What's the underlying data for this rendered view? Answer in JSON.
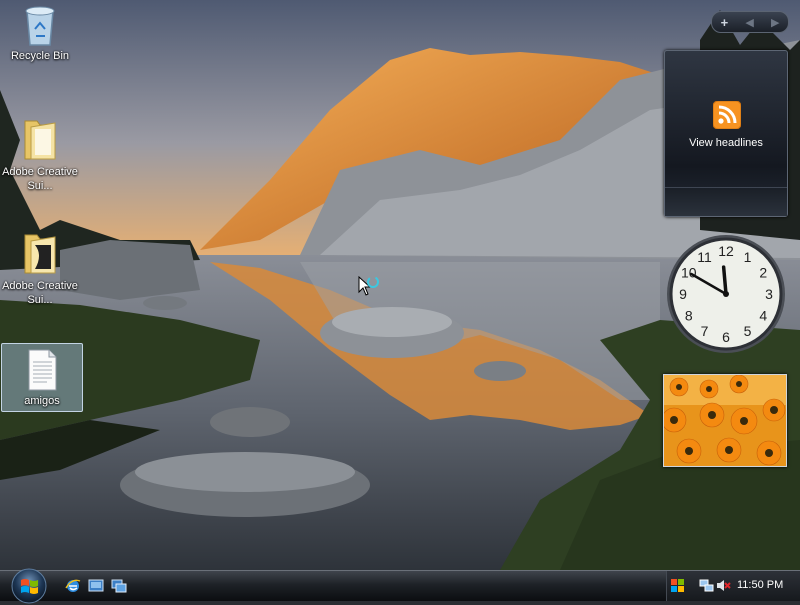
{
  "desktop": {
    "icons": [
      {
        "label": "Recycle Bin",
        "icon": "recycle-bin-icon"
      },
      {
        "label": "Adobe Creative Sui...",
        "icon": "folder-icon"
      },
      {
        "label": "Adobe Creative Sui...",
        "icon": "folder-icon"
      },
      {
        "label": "amigos",
        "icon": "text-document-icon"
      }
    ]
  },
  "sidebar": {
    "controls": {
      "add": "+",
      "prev": "◀",
      "next": "▶"
    },
    "feed_gadget": {
      "label": "View headlines",
      "icon": "rss-icon"
    },
    "clock_gadget": {
      "numerals": [
        "12",
        "1",
        "2",
        "3",
        "4",
        "5",
        "6",
        "7",
        "8",
        "9",
        "10",
        "11"
      ],
      "hour": 11,
      "minute": 50
    },
    "slideshow_gadget": {
      "subject": "orange flowers"
    }
  },
  "taskbar": {
    "start_icon": "windows-orb-icon",
    "quick_launch": [
      "internet-explorer-icon",
      "show-desktop-icon",
      "switch-windows-icon"
    ],
    "tray_icons": [
      "network-icon",
      "volume-muted-icon"
    ],
    "clock": "11:50 PM"
  },
  "colors": {
    "accent": "#f79321",
    "taskbar": "#1e2227"
  }
}
